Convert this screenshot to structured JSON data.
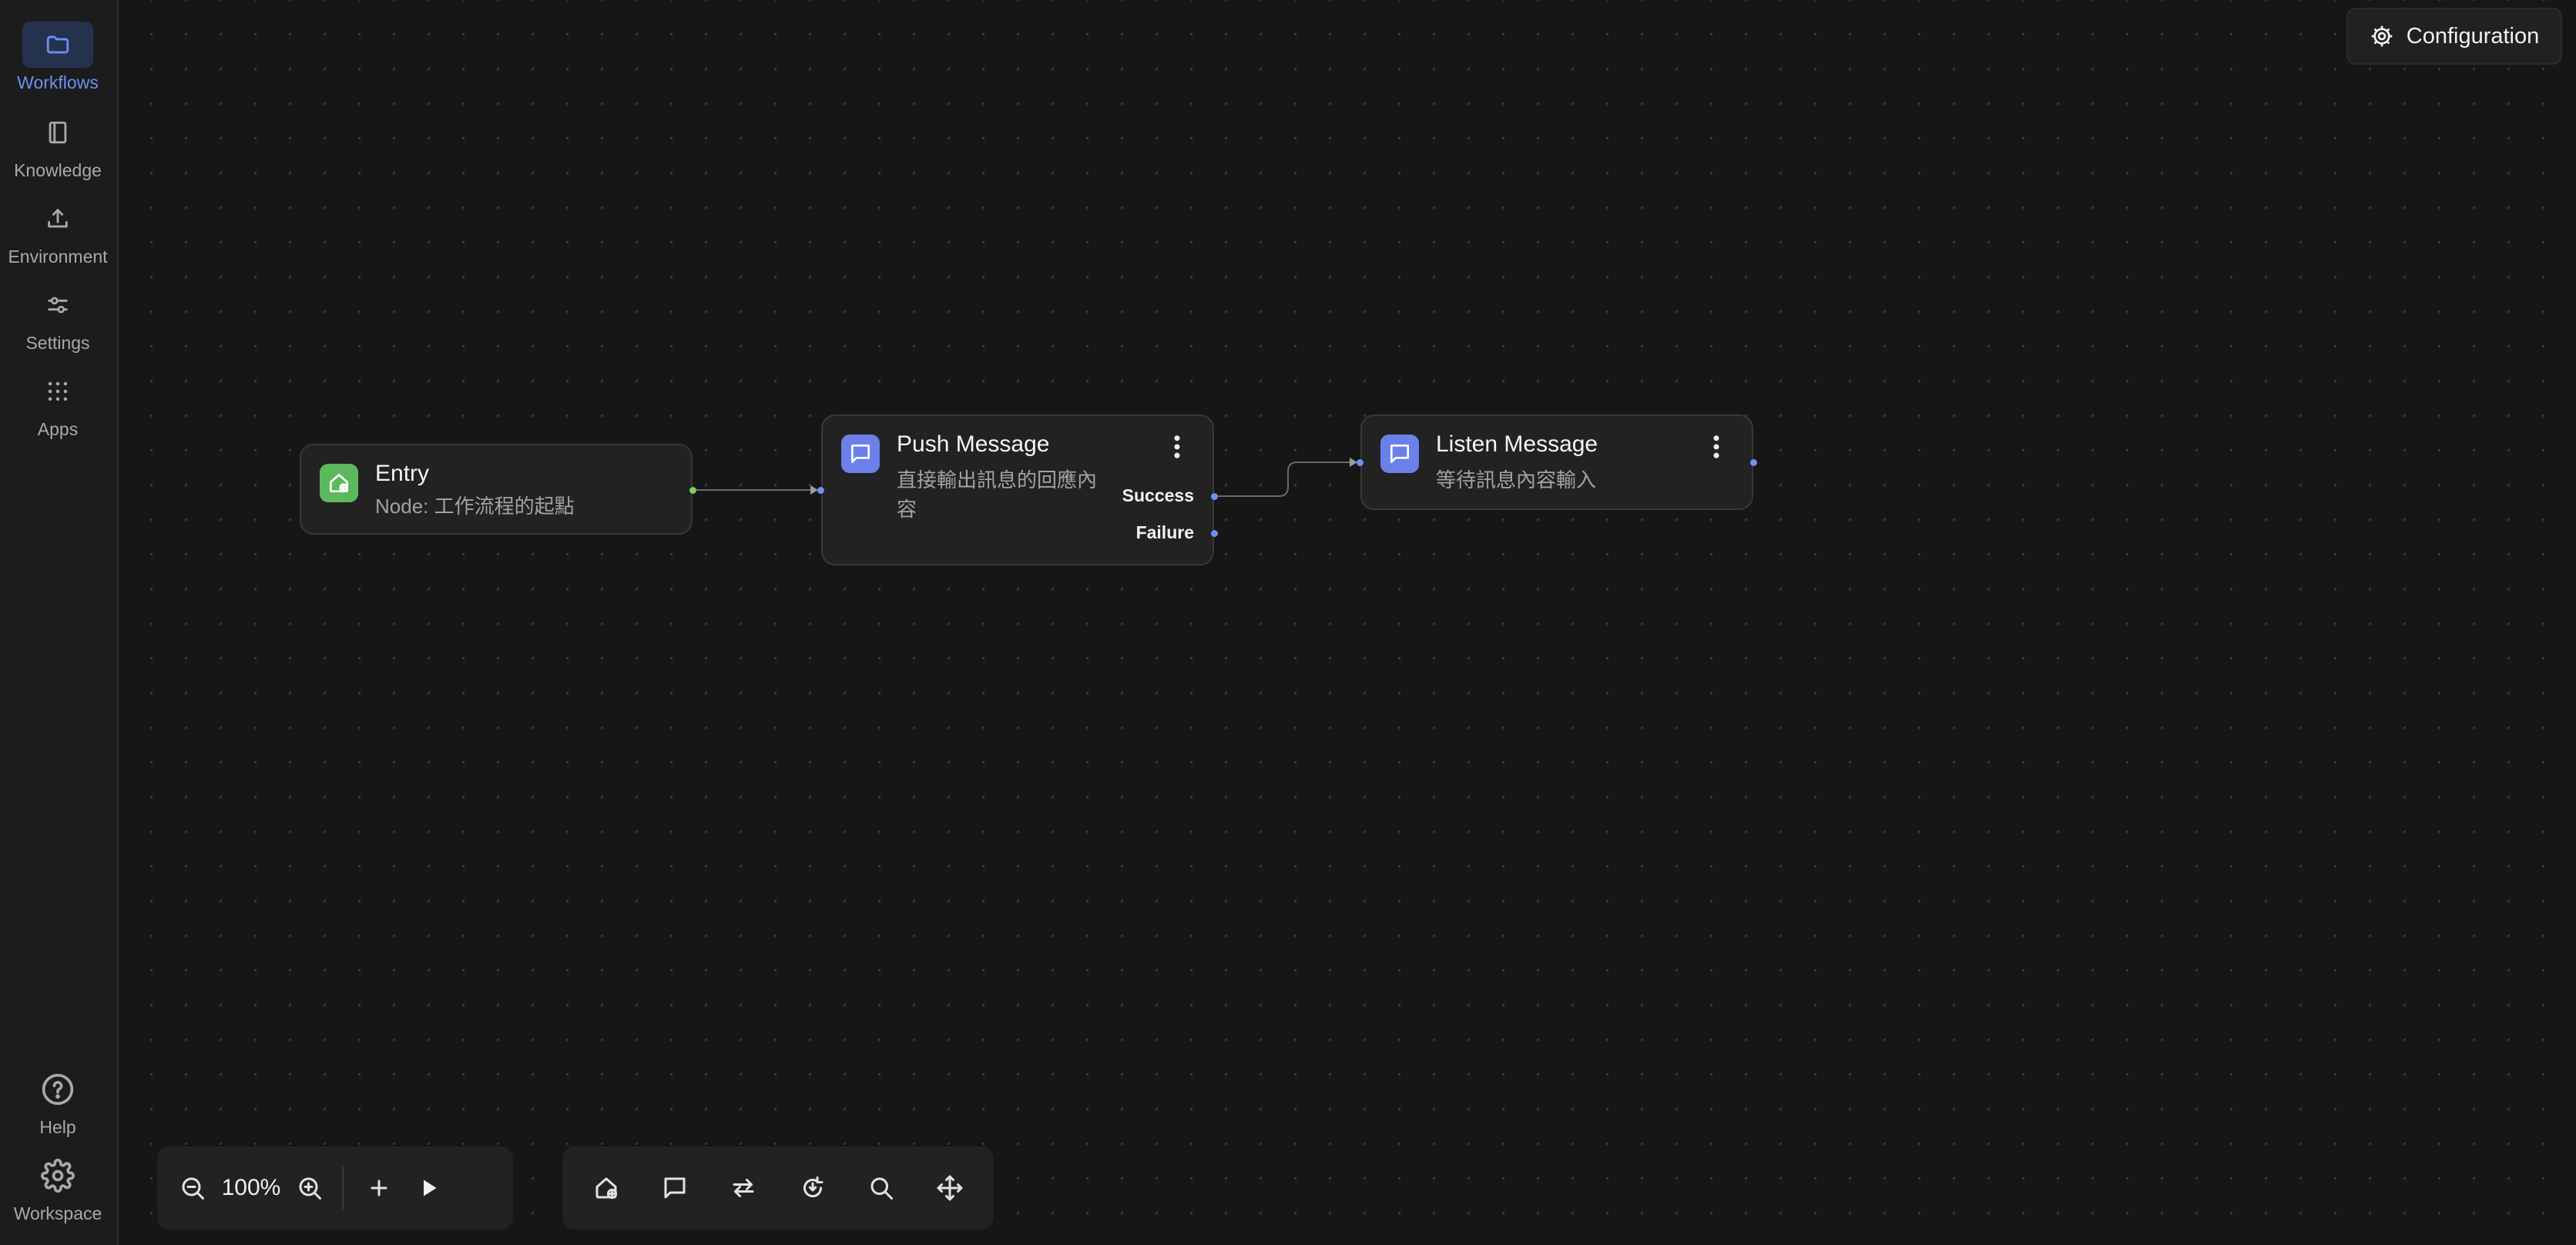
{
  "sidebar": {
    "items": [
      {
        "label": "Workflows",
        "icon": "folder-icon",
        "active": true
      },
      {
        "label": "Knowledge",
        "icon": "book-icon"
      },
      {
        "label": "Environment",
        "icon": "upload-icon"
      },
      {
        "label": "Settings",
        "icon": "sliders-icon"
      },
      {
        "label": "Apps",
        "icon": "grid-icon"
      }
    ],
    "bottom": [
      {
        "label": "Help",
        "icon": "help-circle-icon"
      },
      {
        "label": "Workspace",
        "icon": "gear-icon"
      }
    ]
  },
  "header": {
    "config_label": "Configuration",
    "config_icon": "gear-icon"
  },
  "nodes": {
    "entry": {
      "title": "Entry",
      "subtitle": "Node: 工作流程的起點",
      "icon": "home-plus-icon",
      "color": "#5cb85c"
    },
    "push": {
      "title": "Push Message",
      "subtitle": "直接輸出訊息的回應內容",
      "icon": "message-icon",
      "color": "#6b80e8",
      "ports": {
        "success": "Success",
        "failure": "Failure"
      }
    },
    "listen": {
      "title": "Listen Message",
      "subtitle": "等待訊息內容輸入",
      "icon": "message-icon",
      "color": "#6b80e8"
    }
  },
  "zoom_toolbar": {
    "zoom_level": "100%"
  },
  "tools_toolbar": {
    "icons": [
      "add-entry-icon",
      "comment-icon",
      "swap-icon",
      "auto-layout-icon",
      "search-icon",
      "move-icon"
    ]
  },
  "colors": {
    "accent": "#6e8ff5",
    "entry_green": "#5cb85c",
    "node_blue": "#6b80e8",
    "background": "#161616"
  }
}
